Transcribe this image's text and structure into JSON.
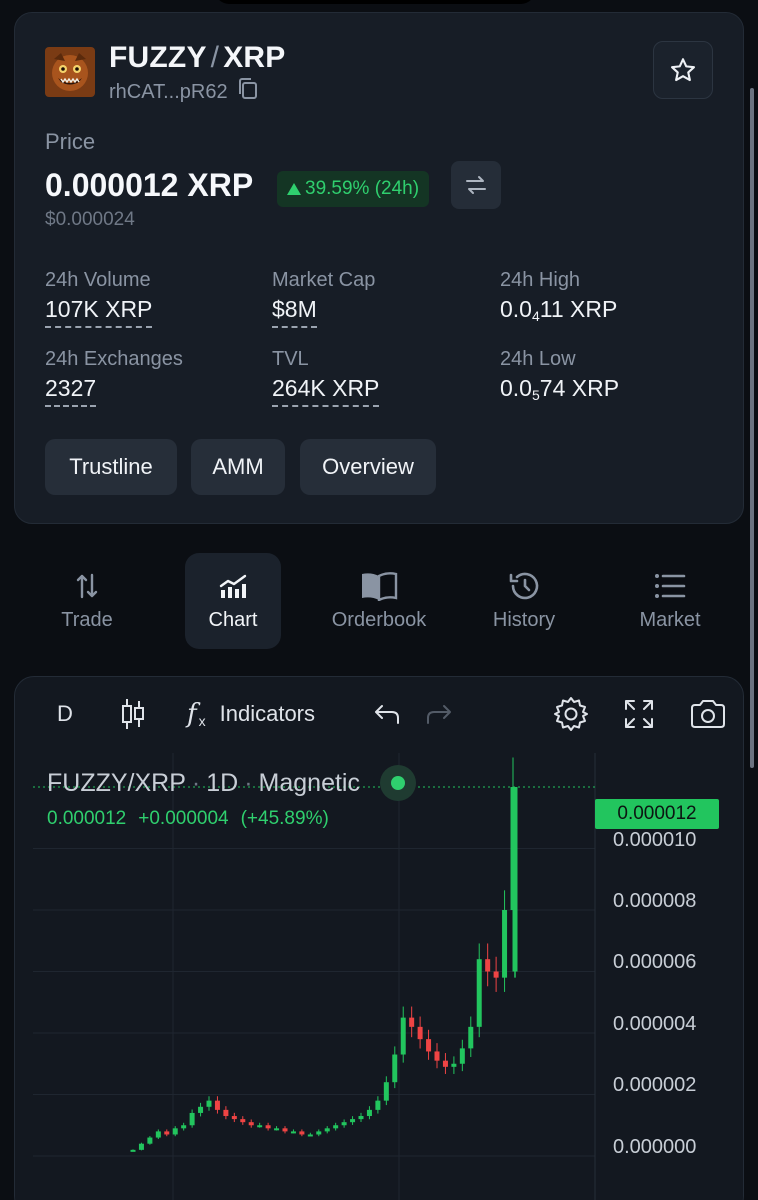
{
  "token": {
    "base": "FUZZY",
    "separator": "/",
    "quote": "XRP",
    "address": "rhCAT...pR62"
  },
  "price": {
    "label": "Price",
    "value": "0.000012 XRP",
    "change": "39.59% (24h)",
    "usd": "$0.000024"
  },
  "stats": [
    {
      "label": "24h Volume",
      "value": "107K XRP"
    },
    {
      "label": "Market Cap",
      "value": "$8M"
    },
    {
      "label": "24h High",
      "value_prefix": "0.0",
      "value_sub": "4",
      "value_suffix": "11 XRP"
    },
    {
      "label": "24h Exchanges",
      "value": "2327"
    },
    {
      "label": "TVL",
      "value": "264K XRP"
    },
    {
      "label": "24h Low",
      "value_prefix": "0.0",
      "value_sub": "5",
      "value_suffix": "74 XRP"
    }
  ],
  "actions": [
    "Trustline",
    "AMM",
    "Overview"
  ],
  "tabs": [
    {
      "label": "Trade",
      "icon": "sort-arrows-icon"
    },
    {
      "label": "Chart",
      "icon": "bar-chart-icon",
      "active": true
    },
    {
      "label": "Orderbook",
      "icon": "book-icon"
    },
    {
      "label": "History",
      "icon": "history-icon"
    },
    {
      "label": "Market",
      "icon": "list-icon"
    }
  ],
  "chart_toolbar": {
    "interval": "D",
    "indicators": "Indicators"
  },
  "chart": {
    "symbol": "FUZZY/XRP",
    "sep": "·",
    "interval": "1D",
    "mode": "Magnetic",
    "ohlc_close": "0.000012",
    "ohlc_change": "+0.000004",
    "ohlc_change_pct": "(+45.89%)",
    "last_price": "0.000012",
    "up_color": "#22c55e",
    "down_color": "#ef4444"
  },
  "chart_data": {
    "type": "candlestick",
    "y_ticks": [
      "0.000012",
      "0.000010",
      "0.000008",
      "0.000006",
      "0.000004",
      "0.000002",
      "0.000000"
    ],
    "ylim": [
      0,
      1.2e-05
    ],
    "grid": true,
    "last_value": 1.2e-05,
    "series_close_approx": [
      2e-07,
      4e-07,
      6e-07,
      8e-07,
      7e-07,
      9e-07,
      1e-06,
      1.4e-06,
      1.6e-06,
      1.8e-06,
      1.5e-06,
      1.3e-06,
      1.2e-06,
      1.1e-06,
      1e-06,
      1e-06,
      9e-07,
      9e-07,
      8e-07,
      8e-07,
      7e-07,
      7e-07,
      8e-07,
      9e-07,
      1e-06,
      1.1e-06,
      1.2e-06,
      1.3e-06,
      1.5e-06,
      1.8e-06,
      2.4e-06,
      3.3e-06,
      4.5e-06,
      4.2e-06,
      3.8e-06,
      3.4e-06,
      3.1e-06,
      2.9e-06,
      3e-06,
      3.5e-06,
      4.2e-06,
      6.4e-06,
      6e-06,
      5.8e-06,
      8e-06,
      1.2e-05
    ]
  }
}
